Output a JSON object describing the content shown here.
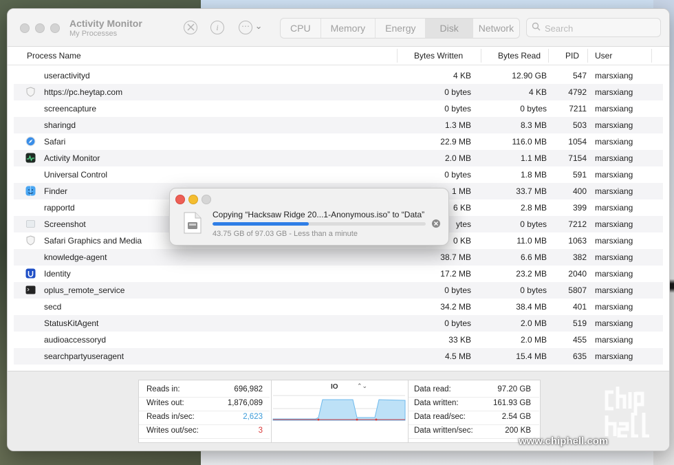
{
  "window": {
    "title": "Activity Monitor",
    "subtitle": "My Processes"
  },
  "toolbar": {
    "stop_icon": "stop-process-icon",
    "info_icon": "info-icon",
    "more_icon": "ellipsis-menu-icon",
    "more_glyph": "⋯",
    "chevron_glyph": "⌄",
    "tabs": [
      "CPU",
      "Memory",
      "Energy",
      "Disk",
      "Network"
    ],
    "active_tab": "Disk",
    "search_placeholder": "Search"
  },
  "table": {
    "columns": [
      "Process Name",
      "Bytes Written",
      "Bytes Read",
      "PID",
      "User"
    ],
    "rows": [
      {
        "name": "useractivityd",
        "written": "4 KB",
        "read": "12.90 GB",
        "pid": "547",
        "user": "marsxiang",
        "icon": "none"
      },
      {
        "name": "https://pc.heytap.com",
        "written": "0 bytes",
        "read": "4 KB",
        "pid": "4792",
        "user": "marsxiang",
        "icon": "shield-icon"
      },
      {
        "name": "screencapture",
        "written": "0 bytes",
        "read": "0 bytes",
        "pid": "7211",
        "user": "marsxiang",
        "icon": "none"
      },
      {
        "name": "sharingd",
        "written": "1.3 MB",
        "read": "8.3 MB",
        "pid": "503",
        "user": "marsxiang",
        "icon": "none"
      },
      {
        "name": "Safari",
        "written": "22.9 MB",
        "read": "116.0 MB",
        "pid": "1054",
        "user": "marsxiang",
        "icon": "safari-icon"
      },
      {
        "name": "Activity Monitor",
        "written": "2.0 MB",
        "read": "1.1 MB",
        "pid": "7154",
        "user": "marsxiang",
        "icon": "activity-monitor-icon"
      },
      {
        "name": "Universal Control",
        "written": "0 bytes",
        "read": "1.8 MB",
        "pid": "591",
        "user": "marsxiang",
        "icon": "none"
      },
      {
        "name": "Finder",
        "written": "1 MB",
        "read": "33.7 MB",
        "pid": "400",
        "user": "marsxiang",
        "icon": "finder-icon"
      },
      {
        "name": "rapportd",
        "written": "6 KB",
        "read": "2.8 MB",
        "pid": "399",
        "user": "marsxiang",
        "icon": "none"
      },
      {
        "name": "Screenshot",
        "written": "ytes",
        "read": "0 bytes",
        "pid": "7212",
        "user": "marsxiang",
        "icon": "screenshot-icon"
      },
      {
        "name": "Safari Graphics and Media",
        "written": "0 KB",
        "read": "11.0 MB",
        "pid": "1063",
        "user": "marsxiang",
        "icon": "shield-icon"
      },
      {
        "name": "knowledge-agent",
        "written": "38.7 MB",
        "read": "6.6 MB",
        "pid": "382",
        "user": "marsxiang",
        "icon": "none"
      },
      {
        "name": "Identity",
        "written": "17.2 MB",
        "read": "23.2 MB",
        "pid": "2040",
        "user": "marsxiang",
        "icon": "identity-icon"
      },
      {
        "name": "oplus_remote_service",
        "written": "0 bytes",
        "read": "0 bytes",
        "pid": "5807",
        "user": "marsxiang",
        "icon": "terminal-icon"
      },
      {
        "name": "secd",
        "written": "34.2 MB",
        "read": "38.4 MB",
        "pid": "401",
        "user": "marsxiang",
        "icon": "none"
      },
      {
        "name": "StatusKitAgent",
        "written": "0 bytes",
        "read": "2.0 MB",
        "pid": "519",
        "user": "marsxiang",
        "icon": "none"
      },
      {
        "name": "audioaccessoryd",
        "written": "33 KB",
        "read": "2.0 MB",
        "pid": "455",
        "user": "marsxiang",
        "icon": "none"
      },
      {
        "name": "searchpartyuseragent",
        "written": "4.5 MB",
        "read": "15.4 MB",
        "pid": "635",
        "user": "marsxiang",
        "icon": "none"
      }
    ]
  },
  "stats_left": [
    {
      "label": "Reads in:",
      "value": "696,982",
      "color": "#222222"
    },
    {
      "label": "Writes out:",
      "value": "1,876,089",
      "color": "#222222"
    },
    {
      "label": "Reads in/sec:",
      "value": "2,623",
      "color": "#3b9bd9"
    },
    {
      "label": "Writes out/sec:",
      "value": "3",
      "color": "#d83a3a"
    }
  ],
  "graph": {
    "label": "IO",
    "chevron_glyph": "⌃⌄",
    "read_color": "#6db9ec",
    "write_color": "#d83a3a"
  },
  "stats_right": [
    {
      "label": "Data read:",
      "value": "97.20 GB"
    },
    {
      "label": "Data written:",
      "value": "161.93 GB"
    },
    {
      "label": "Data read/sec:",
      "value": "2.54 GB"
    },
    {
      "label": "Data written/sec:",
      "value": "200 KB"
    }
  ],
  "copy_dialog": {
    "title": "Copying “Hacksaw Ridge 20...1-Anonymous.iso” to “Data”",
    "status": "43.75 GB of 97.03 GB - Less than a minute",
    "progress": 0.4509,
    "icon": "disk-image-file-icon",
    "cancel_icon": "cancel-x-icon"
  },
  "watermark": {
    "url": "www.chiphell.com",
    "logo": "chiphell-logo"
  }
}
